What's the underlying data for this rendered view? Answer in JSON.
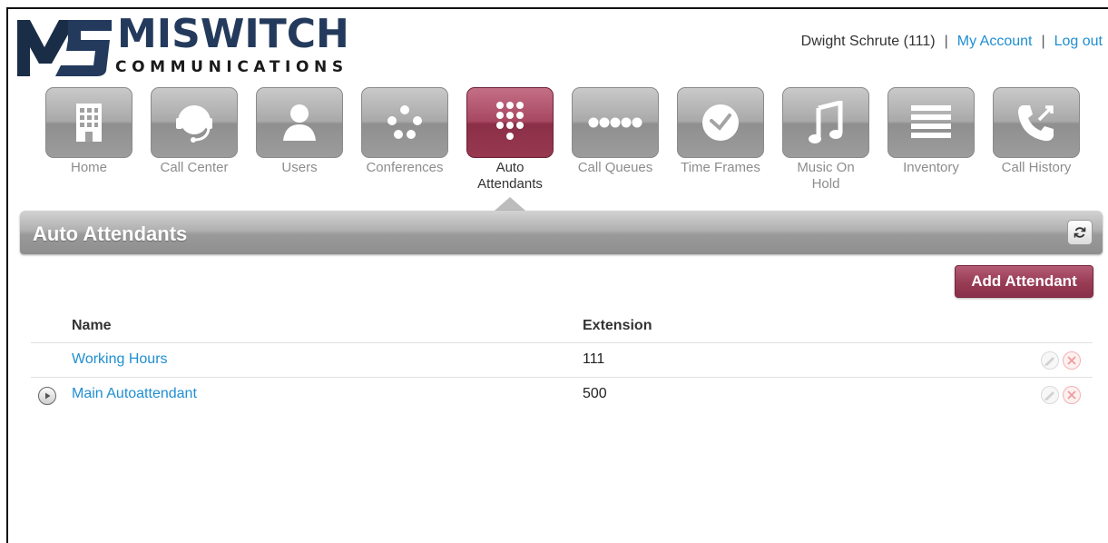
{
  "logo": {
    "name": "MISWITCH",
    "subtitle": "COMMUNICATIONS",
    "mark_letters": "MS",
    "colors": {
      "navy": "#233a5c",
      "mark": "#1a2d47"
    }
  },
  "user": {
    "display": "Dwight Schrute (111)",
    "separator": "|",
    "my_account": "My Account",
    "logout": "Log out"
  },
  "nav": {
    "items": [
      {
        "label": "Home",
        "icon": "building-icon"
      },
      {
        "label": "Call Center",
        "icon": "headset-icon"
      },
      {
        "label": "Users",
        "icon": "user-icon"
      },
      {
        "label": "Conferences",
        "icon": "dots-group-icon"
      },
      {
        "label": "Auto Attendants",
        "icon": "keypad-icon",
        "active": true
      },
      {
        "label": "Call Queues",
        "icon": "queue-dots-icon"
      },
      {
        "label": "Time Frames",
        "icon": "clock-icon"
      },
      {
        "label": "Music On Hold",
        "icon": "music-note-icon"
      },
      {
        "label": "Inventory",
        "icon": "list-icon"
      },
      {
        "label": "Call History",
        "icon": "phone-arrows-icon"
      }
    ]
  },
  "section": {
    "title": "Auto Attendants",
    "refresh_icon": "refresh-icon"
  },
  "actions": {
    "add_label": "Add Attendant"
  },
  "table": {
    "columns": [
      "Name",
      "Extension"
    ],
    "rows": [
      {
        "name": "Working Hours",
        "extension": "111",
        "has_play": false
      },
      {
        "name": "Main Autoattendant",
        "extension": "500",
        "has_play": true
      }
    ]
  },
  "colors": {
    "link": "#1f8fd1",
    "accent": "#9b3e58",
    "nav_gray": "#a9a9a9"
  }
}
